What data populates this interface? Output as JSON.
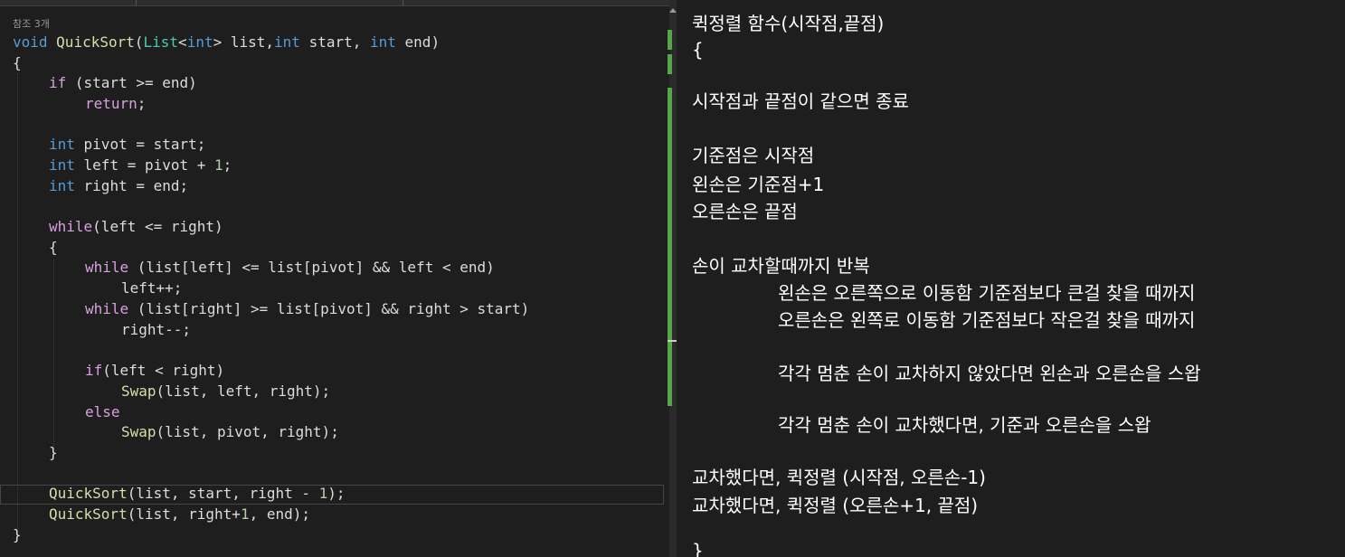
{
  "editor": {
    "references": "참조 3개",
    "lines": [
      [
        "void",
        " ",
        "QuickSort",
        "(",
        "List",
        "<",
        "int",
        "> list,",
        "int",
        " start, ",
        "int",
        " end)"
      ],
      [
        "{"
      ],
      [
        "if",
        " (start >= end)"
      ],
      [
        "return",
        ";"
      ],
      [
        "int",
        " pivot = start;"
      ],
      [
        "int",
        " left = pivot + ",
        "1",
        ";"
      ],
      [
        "int",
        " right = end;"
      ],
      [
        "while",
        "(left <= right)"
      ],
      [
        "{"
      ],
      [
        "while",
        " (list[left] <= list[pivot] && left < end)"
      ],
      [
        "left++;"
      ],
      [
        "while",
        " (list[right] >= list[pivot] && right > start)"
      ],
      [
        "right--;"
      ],
      [
        "if",
        "(left < right)"
      ],
      [
        "Swap",
        "(list, left, right);"
      ],
      [
        "else"
      ],
      [
        "Swap",
        "(list, pivot, right);"
      ],
      [
        "}"
      ],
      [
        "QuickSort",
        "(list, start, right - ",
        "1",
        ");"
      ],
      [
        "QuickSort",
        "(list, right+",
        "1",
        ", end);"
      ],
      [
        "}"
      ]
    ]
  },
  "notes": {
    "lines": [
      "퀵정렬 함수(시작점,끝점)",
      "{",
      "시작점과 끝점이 같으면 종료",
      "기준점은 시작점",
      "왼손은 기준점+1",
      "오른손은 끝점",
      "손이 교차할때까지 반복",
      "왼손은 오른쪽으로 이동함 기준점보다 큰걸 찾을 때까지",
      "오른손은 왼쪽로 이동함 기준점보다 작은걸 찾을 때까지",
      "각각 멈춘 손이 교차하지 않았다면 왼손과 오른손을 스왑",
      "각각 멈춘 손이 교차했다면, 기준과 오른손을 스왑",
      "교차했다면, 퀵정렬 (시작점, 오른손-1)",
      "교차했다면, 퀵정렬 (오른손+1, 끝점)",
      "}"
    ]
  },
  "colors": {
    "background": "#1e1e1e",
    "keyword": "#569cd6",
    "control": "#d8a0df",
    "type": "#4ec9b0",
    "function": "#dcdcaa",
    "number": "#b5cea8",
    "text": "#dcdcdc",
    "change_marker": "#57a64a"
  }
}
